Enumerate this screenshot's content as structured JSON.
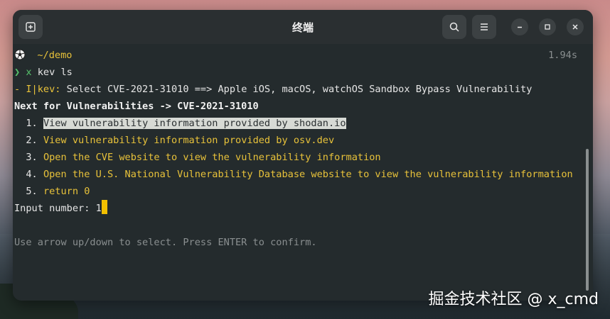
{
  "window": {
    "title": "终端"
  },
  "prompt": {
    "path": "~/demo",
    "elapsed": "1.94s",
    "arrow": "❯",
    "marker": "x",
    "command": "kev ls"
  },
  "output": {
    "info_prefix": "- I|kev:",
    "info_text": " Select CVE-2021-31010 ==> Apple iOS, macOS, watchOS Sandbox Bypass Vulnerability",
    "next_header": "Next for Vulnerabilities -> CVE-2021-31010",
    "options": [
      {
        "num": "1.",
        "label": "View vulnerability information provided by shodan.io"
      },
      {
        "num": "2.",
        "label": "View vulnerability information provided by osv.dev"
      },
      {
        "num": "3.",
        "label": "Open the CVE website to view the vulnerability information"
      },
      {
        "num": "4.",
        "label": "Open the U.S. National Vulnerability Database website to view the vulnerability information"
      },
      {
        "num": "5.",
        "label": "return 0"
      }
    ],
    "input_label": "Input number: ",
    "input_value": "1",
    "hint": "Use arrow up/down to select. Press ENTER to confirm."
  },
  "watermark": "掘金技术社区 @ x_cmd",
  "colors": {
    "terminal_bg": "#242b2d",
    "accent_yellow": "#e8c23a",
    "cursor": "#f2c000",
    "prompt_green": "#56c36b"
  },
  "icons": {
    "new_tab": "new-tab-icon",
    "search": "search-icon",
    "menu": "hamburger-menu-icon",
    "minimize": "minimize-icon",
    "maximize": "maximize-icon",
    "close": "close-icon",
    "prompt": "soccer-ball-icon"
  }
}
